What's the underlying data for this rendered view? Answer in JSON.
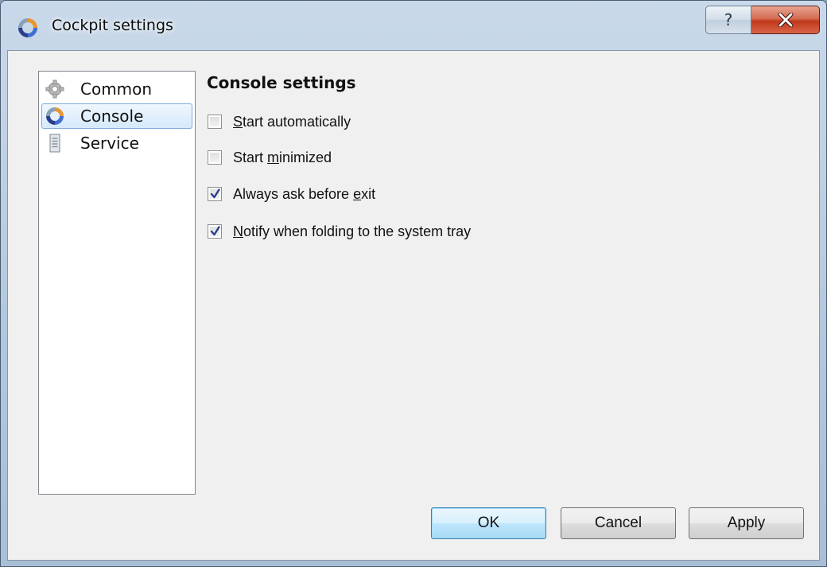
{
  "window": {
    "title": "Cockpit settings",
    "help_button": "?"
  },
  "nav": {
    "items": [
      {
        "label": "Common",
        "icon": "gear-icon",
        "selected": false
      },
      {
        "label": "Console",
        "icon": "cockpit-ring-icon",
        "selected": true
      },
      {
        "label": "Service",
        "icon": "document-icon",
        "selected": false
      }
    ]
  },
  "console": {
    "section_title": "Console settings",
    "options": [
      {
        "label_mnemonic": "S",
        "label_rest": "tart automatically",
        "checked": false
      },
      {
        "label_pre": "Start ",
        "label_mnemonic": "m",
        "label_rest": "inimized",
        "checked": false
      },
      {
        "label_pre": "Always ask before ",
        "label_mnemonic": "e",
        "label_rest": "xit",
        "checked": true
      },
      {
        "label_mnemonic": "N",
        "label_rest": "otify when folding to the system tray",
        "checked": true
      }
    ]
  },
  "buttons": {
    "ok": "OK",
    "cancel": "Cancel",
    "apply": "Apply"
  },
  "colors": {
    "title_bar": "#b3c7dc",
    "close_button": "#c1391c",
    "selection": "#d6eafb",
    "default_button": "#bee6fd",
    "check_mark": "#2b3f8f"
  }
}
